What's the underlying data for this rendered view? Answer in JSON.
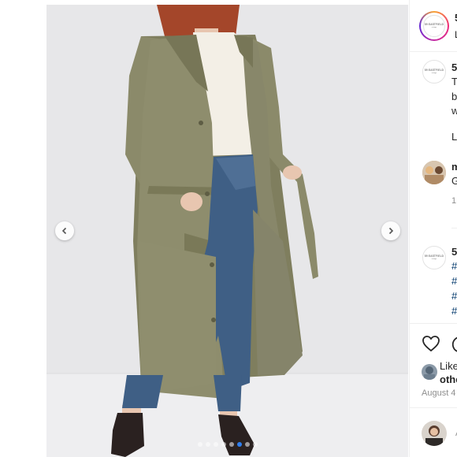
{
  "post": {
    "account": {
      "handle_truncated": "5",
      "location_truncated": "L",
      "logo_text": "59 EASTFIELD",
      "logo_sub": "vintage"
    },
    "caption": {
      "handle_truncated": "5",
      "lines": [
        "T",
        "b",
        "w",
        "L"
      ]
    },
    "comment1": {
      "user_truncated": "m",
      "text_truncated": "G",
      "meta_truncated": "1"
    },
    "comment2": {
      "handle_truncated": "5",
      "hashtags": [
        "#",
        "#",
        "#",
        "#"
      ]
    },
    "likes": {
      "prefix": "Like",
      "suffix": "othe"
    },
    "date_truncated": "August 4",
    "comment_input_placeholder_truncated": "A",
    "carousel": {
      "total_slides": 8,
      "active_index": 5
    }
  },
  "colors": {
    "accent": "#2f7ff0",
    "hashtag": "#00376b",
    "background_wall": "#e6e6e8",
    "coat": "#8a8a6a",
    "jeans": "#3f5f85"
  },
  "icons": {
    "prev": "chevron-left-icon",
    "next": "chevron-right-icon",
    "like": "heart-icon",
    "comment": "comment-bubble-icon"
  }
}
